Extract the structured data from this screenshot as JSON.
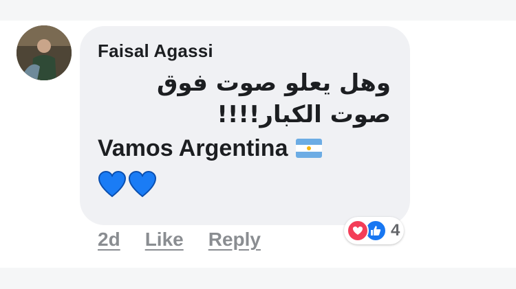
{
  "comment": {
    "author": "Faisal Agassi",
    "text_arabic": "وهل يعلو صوت فوق صوت الكبار!!!!",
    "text_line": "Vamos Argentina",
    "flag": "argentina-flag-icon",
    "emoji": [
      "blue-heart-icon",
      "blue-heart-icon"
    ]
  },
  "reactions": {
    "icons": [
      "love-reaction-icon",
      "like-reaction-icon"
    ],
    "count": "4"
  },
  "actions": {
    "time": "2d",
    "like": "Like",
    "reply": "Reply"
  },
  "colors": {
    "bubble": "#f0f1f4",
    "love": "#f33e58",
    "like": "#1877f2",
    "heart": "#1a7cf5",
    "meta_text": "#8a8d91"
  }
}
